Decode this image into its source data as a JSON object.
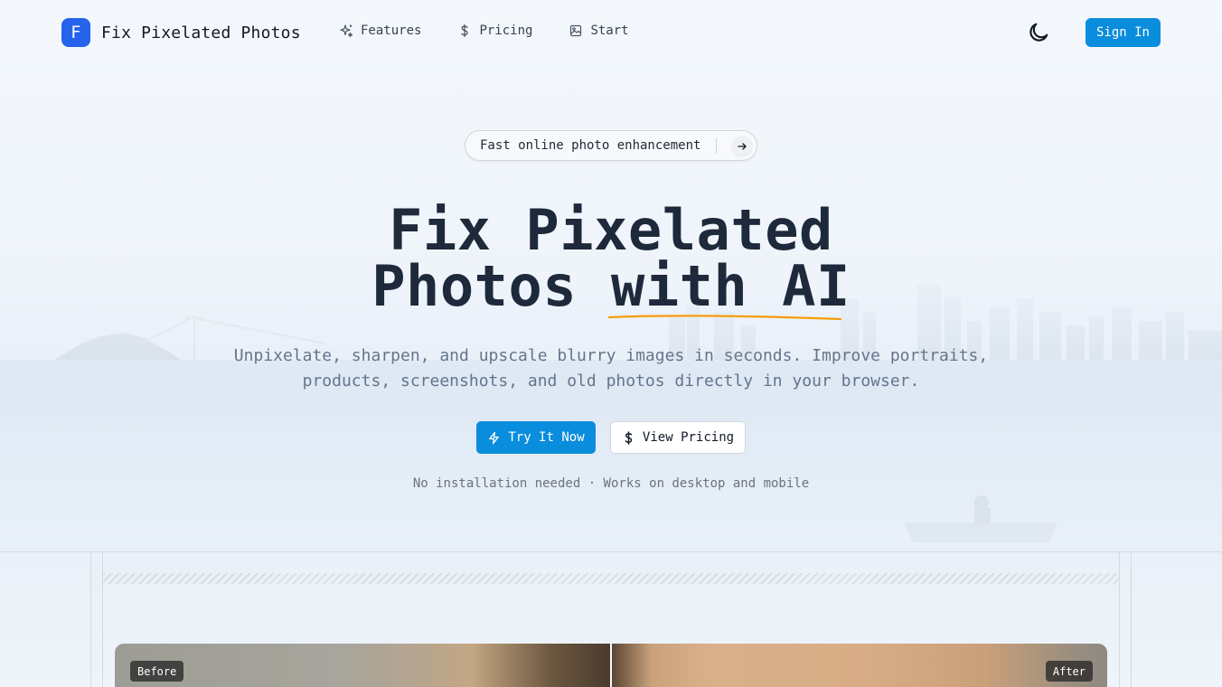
{
  "nav": {
    "brand_letter": "F",
    "brand_name": "Fix Pixelated Photos",
    "links": [
      {
        "label": "Features",
        "icon": "sparkles-icon"
      },
      {
        "label": "Pricing",
        "icon": "dollar-icon"
      },
      {
        "label": "Start",
        "icon": "image-icon"
      }
    ],
    "theme_icon": "moon-icon",
    "sign_in": "Sign In"
  },
  "hero": {
    "pill_text": "Fast online photo enhancement",
    "title_line1": "Fix Pixelated",
    "title_line2_plain": "Photos",
    "title_line2_highlight": "with AI",
    "subtitle": "Unpixelate, sharpen, and upscale blurry images in seconds. Improve portraits, products, screenshots, and old photos directly in your browser.",
    "primary_cta": "Try It Now",
    "secondary_cta": "View Pricing",
    "note": "No installation needed · Works on desktop and mobile"
  },
  "compare": {
    "before_label": "Before",
    "after_label": "After"
  },
  "colors": {
    "accent": "#0a8ddc",
    "logo": "#2563eb",
    "heading": "#1e293b",
    "underline": "#f59e0b"
  }
}
